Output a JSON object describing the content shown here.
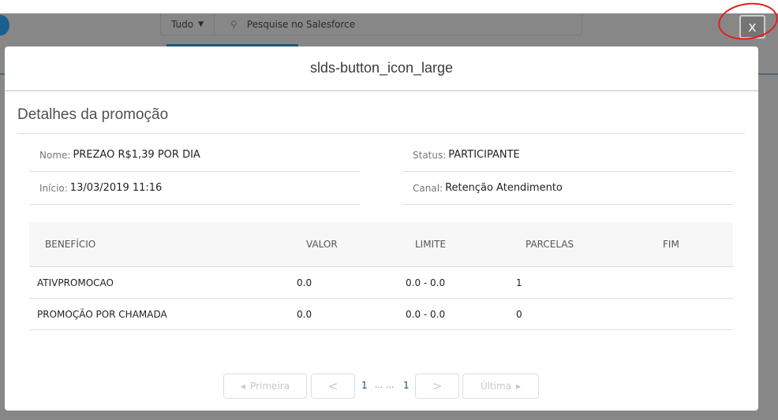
{
  "topbar": {
    "scope": "Tudo",
    "search_placeholder": "Pesquise no Salesforce",
    "close_label": "x"
  },
  "modal": {
    "title": "slds-button_icon_large",
    "section_title": "Detalhes da promoção",
    "fields": {
      "nome_label": "Nome:",
      "nome": "PREZAO R$1,39 POR DIA",
      "status_label": "Status:",
      "status": "PARTICIPANTE",
      "inicio_label": "Início:",
      "inicio": "13/03/2019 11:16",
      "canal_label": "Canal:",
      "canal": "Retenção Atendimento"
    },
    "table": {
      "headers": [
        "BENEFÍCIO",
        "VALOR",
        "LIMITE",
        "PARCELAS",
        "FIM"
      ],
      "rows": [
        [
          "ATIVPROMOCAO",
          "0.0",
          "0.0 - 0.0",
          "1",
          ""
        ],
        [
          "PROMOÇÃO POR CHAMADA",
          "0.0",
          "0.0 - 0.0",
          "0",
          ""
        ]
      ]
    },
    "pagination": {
      "first": "Primeira",
      "prev": "<",
      "current": "1",
      "dots": "... ...",
      "last_page": "1",
      "next": ">",
      "last": "Última"
    }
  }
}
